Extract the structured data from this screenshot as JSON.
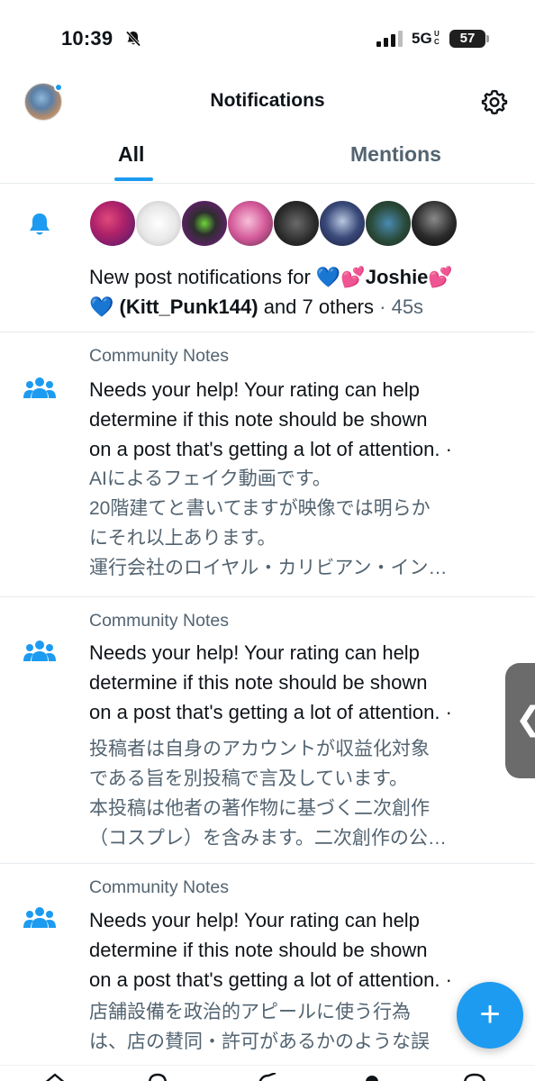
{
  "status_bar": {
    "time": "10:39",
    "network": "5G",
    "network_sub": "UC",
    "battery": "57"
  },
  "header": {
    "title": "Notifications"
  },
  "tabs": [
    {
      "label": "All",
      "active": true
    },
    {
      "label": "Mentions",
      "active": false
    }
  ],
  "notifications": [
    {
      "type": "new-post",
      "icon": "bell-icon",
      "avatar_count": 8,
      "text_prefix": "New post notifications for ",
      "heart1": "💙",
      "heart2": "💕",
      "name": "Joshie",
      "heart3": "💕",
      "heart4": "💙",
      "handle": "(Kitt_Punk144)",
      "text_suffix": " and 7 others",
      "time": "· 45s"
    },
    {
      "type": "community-note",
      "icon": "people-icon",
      "label": "Community Notes",
      "body_lines": [
        "Needs your help! Your rating can help",
        "determine if this note should be shown",
        "on a post that's getting a lot of attention. ·"
      ],
      "quote_lines": [
        "AIによるフェイク動画です。",
        "20階建てと書いてますが映像では明らか",
        "にそれ以上あります。",
        "運行会社のロイヤル・カリビアン・イン…"
      ]
    },
    {
      "type": "community-note",
      "icon": "people-icon",
      "label": "Community Notes",
      "body_lines": [
        "Needs your help! Your rating can help",
        "determine if this note should be shown",
        "on a post that's getting a lot of attention. ·"
      ],
      "quote_lines": [
        "投稿者は自身のアカウントが収益化対象",
        "である旨を別投稿で言及しています。",
        "本投稿は他者の著作物に基づく二次創作",
        "（コスプレ）を含みます。二次創作の公…"
      ]
    },
    {
      "type": "community-note",
      "icon": "people-icon",
      "label": "Community Notes",
      "body_lines": [
        "Needs your help! Your rating can help",
        "determine if this note should be shown",
        "on a post that's getting a lot of attention. ·"
      ],
      "quote_lines": [
        "店舗設備を政治的アピールに使う行為",
        "は、店の賛同・許可があるかのような誤"
      ]
    }
  ],
  "colors": {
    "accent": "#1d9bf0",
    "text_primary": "#0f1419",
    "text_secondary": "#536471",
    "divider": "#e6ecf0"
  },
  "side_handle": {
    "glyph": "❮"
  },
  "fab": {
    "label": "+",
    "icon": "compose-plus-icon"
  }
}
